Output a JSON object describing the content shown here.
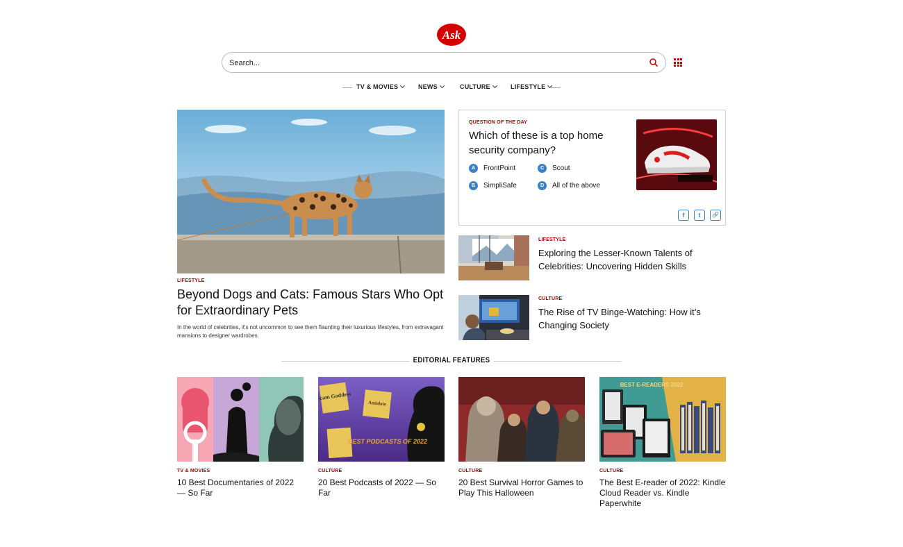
{
  "brand": {
    "logo_text": "Ask",
    "color": "#d50000"
  },
  "search": {
    "placeholder": "Search..."
  },
  "nav": {
    "items": [
      {
        "label": "TV & MOVIES"
      },
      {
        "label": "NEWS"
      },
      {
        "label": "CULTURE"
      },
      {
        "label": "LIFESTYLE"
      }
    ]
  },
  "hero": {
    "category": "LIFESTYLE",
    "title": "Beyond Dogs and Cats: Famous Stars Who Opt for Extraordinary Pets",
    "description": "In the world of celebrities, it's not uncommon to see them flaunting their luxurious lifestyles, from extravagant mansions to designer wardrobes."
  },
  "quiz": {
    "label": "QUESTION OF THE DAY",
    "question": "Which of these is a top home security company?",
    "options": [
      {
        "letter": "A",
        "text": "FrontPoint"
      },
      {
        "letter": "B",
        "text": "SimpliSafe"
      },
      {
        "letter": "C",
        "text": "Scout"
      },
      {
        "letter": "D",
        "text": "All of the above"
      }
    ],
    "share": {
      "facebook": "f",
      "twitter": "t",
      "link": "🔗"
    }
  },
  "side_stories": [
    {
      "category": "LIFESTYLE",
      "title": "Exploring the Lesser-Known Talents of Celebrities: Uncovering Hidden Skills"
    },
    {
      "category": "CULTURE",
      "title": "The Rise of TV Binge-Watching: How it’s Changing Society"
    }
  ],
  "editorial": {
    "heading": "EDITORIAL FEATURES",
    "cards": [
      {
        "category": "TV & MOVIES",
        "title": "10 Best Documentaries of 2022 — So Far"
      },
      {
        "category": "CULTURE",
        "title": "20 Best Podcasts of 2022 — So Far"
      },
      {
        "category": "CULTURE",
        "title": "20 Best Survival Horror Games to Play This Halloween"
      },
      {
        "category": "CULTURE",
        "title": "The Best E-reader of 2022: Kindle Cloud Reader vs. Kindle Paperwhite"
      }
    ],
    "image_text": {
      "podcast_badge_1": "Scam Goddess",
      "podcast_badge_2": "Antidote",
      "podcast_title": "BEST PODCASTS OF 2022",
      "ereader_title": "BEST E-READERS 2022"
    }
  },
  "colors": {
    "accent": "#b30000",
    "quiz_blue": "#3a82c4"
  }
}
